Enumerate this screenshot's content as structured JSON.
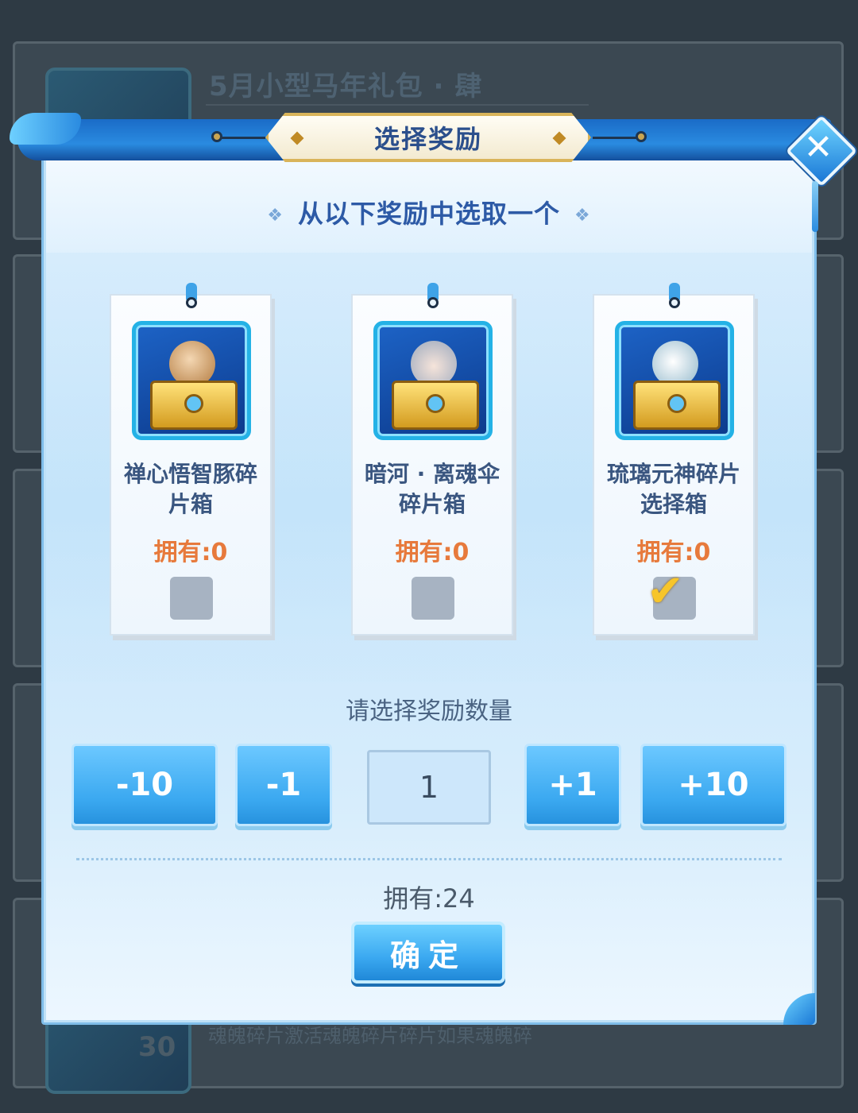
{
  "background": {
    "pack_title": "5月小型马年礼包 · 肆",
    "footer_text": "魂魄碎片激活魂魄碎片碎片如果魂魄碎",
    "badge_count": "30"
  },
  "dialog": {
    "title": "选择奖励",
    "close_icon": "close-icon",
    "subtitle": "从以下奖励中选取一个",
    "subtitle_ornament": "❖"
  },
  "rewards": [
    {
      "name": "禅心悟智豚碎片箱",
      "owned": "拥有:0",
      "selected": false
    },
    {
      "name": "暗河 · 离魂伞碎片箱",
      "owned": "拥有:0",
      "selected": false
    },
    {
      "name": "琉璃元神碎片选择箱",
      "owned": "拥有:0",
      "selected": true
    }
  ],
  "quantity": {
    "label": "请选择奖励数量",
    "minus10": "-10",
    "minus1": "-1",
    "value": "1",
    "plus1": "+1",
    "plus10": "+10"
  },
  "owned_total": "拥有:24",
  "confirm_label": "确定",
  "colors": {
    "accent": "#3aa8f0",
    "owned_text": "#e77a3c",
    "title_text": "#2b4f8c",
    "check": "#f7c52a"
  }
}
